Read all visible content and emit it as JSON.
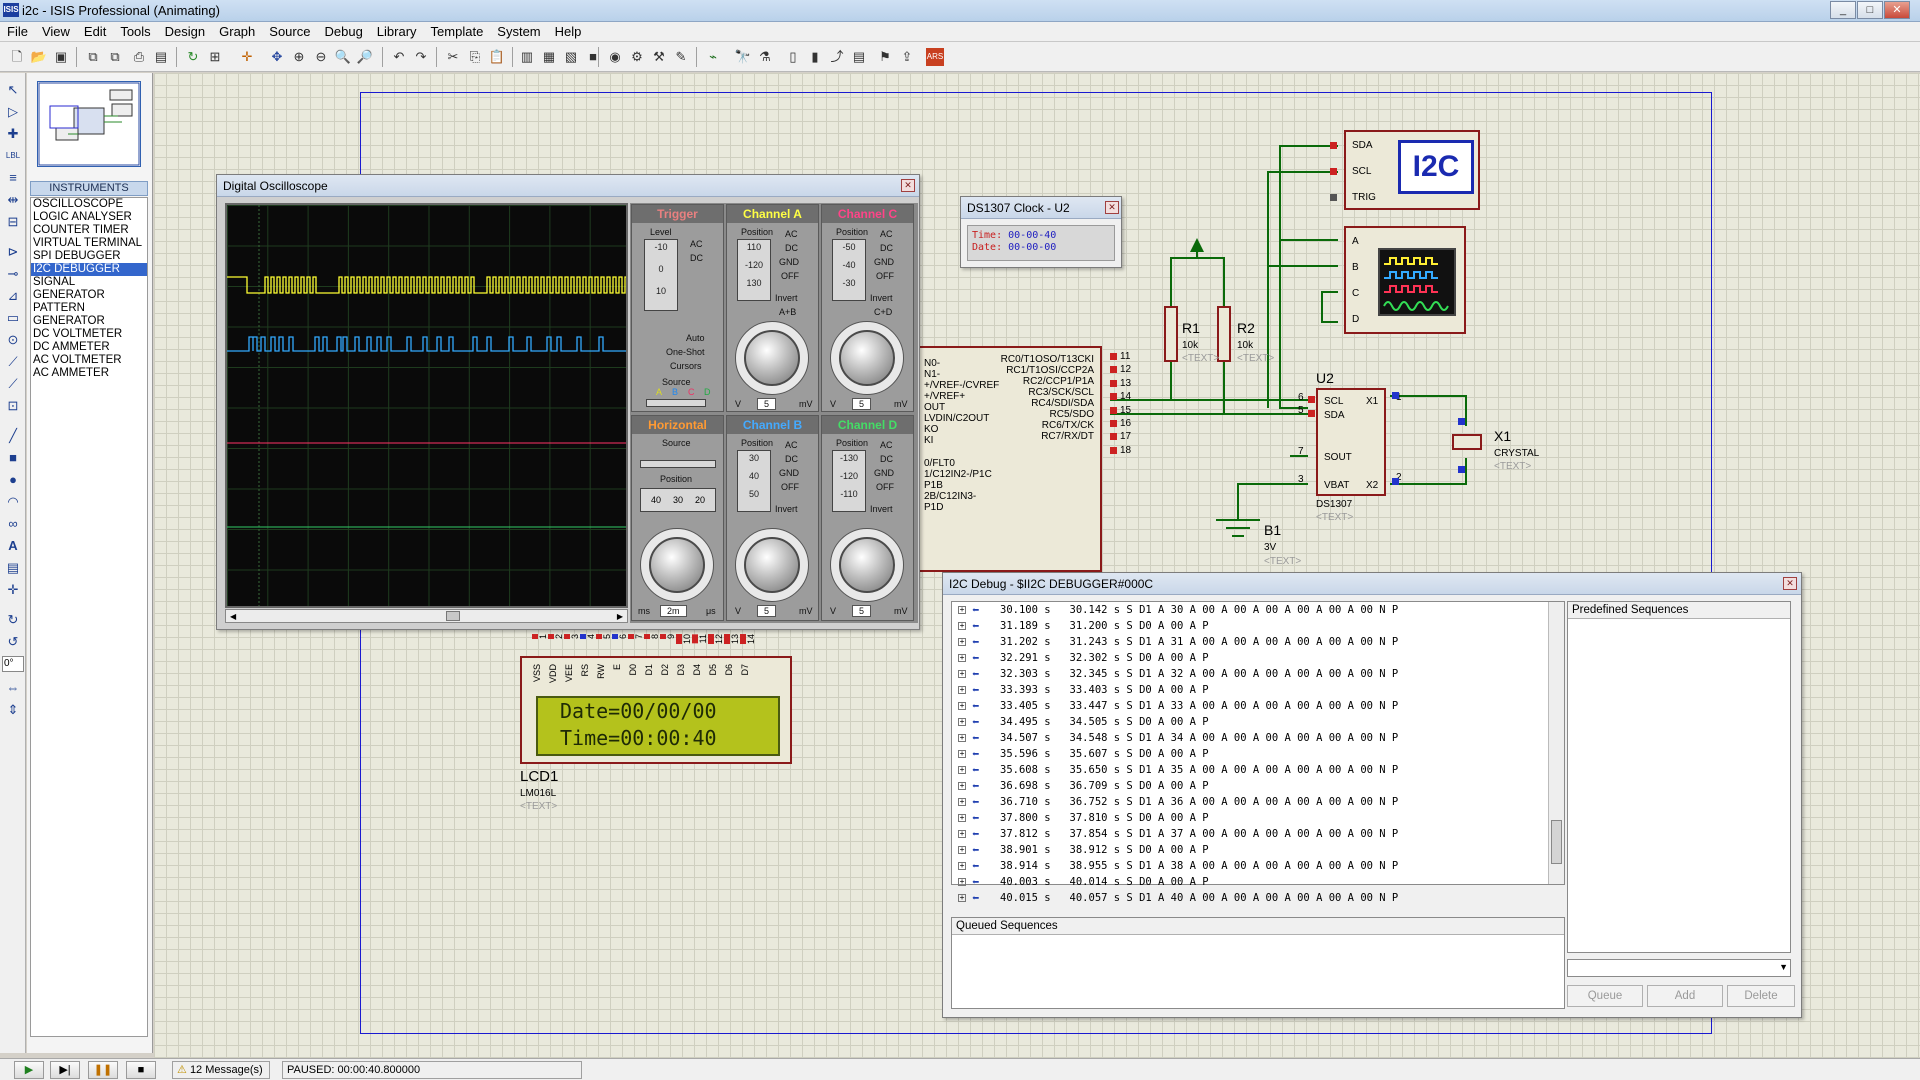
{
  "app": {
    "title": "i2c - ISIS Professional (Animating)",
    "logo": "ISIS"
  },
  "menu": [
    "File",
    "View",
    "Edit",
    "Tools",
    "Design",
    "Graph",
    "Source",
    "Debug",
    "Library",
    "Template",
    "System",
    "Help"
  ],
  "instruments": {
    "header": "INSTRUMENTS",
    "items": [
      "OSCILLOSCOPE",
      "LOGIC ANALYSER",
      "COUNTER TIMER",
      "VIRTUAL TERMINAL",
      "SPI DEBUGGER",
      "I2C DEBUGGER",
      "SIGNAL GENERATOR",
      "PATTERN GENERATOR",
      "DC VOLTMETER",
      "DC AMMETER",
      "AC VOLTMETER",
      "AC AMMETER"
    ],
    "selected_index": 5
  },
  "angle_field": "0°",
  "status": {
    "messages": "12 Message(s)",
    "state": "PAUSED: 00:00:40.800000"
  },
  "oscilloscope": {
    "title": "Digital Oscilloscope",
    "trigger": {
      "title": "Trigger",
      "level_label": "Level",
      "ticks": [
        "-10",
        "0",
        "10"
      ],
      "ac": "AC",
      "dc": "DC",
      "auto": "Auto",
      "one_shot": "One-Shot",
      "cursors": "Cursors",
      "source": "Source",
      "channels": [
        "A",
        "B",
        "C",
        "D"
      ]
    },
    "channel_a": {
      "title": "Channel A",
      "position": "Position",
      "ticks": [
        "110",
        "-120",
        "130"
      ],
      "modes": [
        "AC",
        "DC",
        "GND",
        "OFF"
      ],
      "invert": "Invert",
      "sum": "A+B",
      "v": "V",
      "mv": "mV",
      "value": "5"
    },
    "channel_c": {
      "title": "Channel C",
      "position": "Position",
      "ticks": [
        "-50",
        "-40",
        "-30"
      ],
      "modes": [
        "AC",
        "DC",
        "GND",
        "OFF"
      ],
      "invert": "Invert",
      "sum": "C+D",
      "v": "V",
      "mv": "mV",
      "value": "5"
    },
    "horizontal": {
      "title": "Horizontal",
      "source": "Source",
      "position": "Position",
      "ticks": [
        "40",
        "30",
        "20"
      ],
      "ms": "ms",
      "us": "μs",
      "value": "2m"
    },
    "channel_b": {
      "title": "Channel B",
      "position": "Position",
      "ticks": [
        "30",
        "40",
        "50"
      ],
      "modes": [
        "AC",
        "DC",
        "GND",
        "OFF"
      ],
      "invert": "Invert",
      "v": "V",
      "mv": "mV",
      "value": "5"
    },
    "channel_d": {
      "title": "Channel D",
      "position": "Position",
      "ticks": [
        "-130",
        "-120",
        "-110"
      ],
      "modes": [
        "AC",
        "DC",
        "GND",
        "OFF"
      ],
      "invert": "Invert",
      "v": "V",
      "mv": "mV",
      "value": "5"
    },
    "colors": {
      "a": "#ffff33",
      "b": "#33aaff",
      "c": "#ff3366",
      "d": "#33cc66"
    }
  },
  "ds1307_window": {
    "title": "DS1307 Clock - U2",
    "time_label": "Time:",
    "time": "00-00-40",
    "date_label": "Date:",
    "date": "00-00-00"
  },
  "lcd": {
    "line1": "Date=00/00/00",
    "line2": "Time=00:00:40",
    "ref": "LCD1",
    "model": "LM016L",
    "text": "<TEXT>",
    "pins": [
      "VSS",
      "VDD",
      "VEE",
      "RS",
      "RW",
      "E",
      "D0",
      "D1",
      "D2",
      "D3",
      "D4",
      "D5",
      "D6",
      "D7"
    ]
  },
  "schematic": {
    "i2c_box": {
      "label": "I2C",
      "pins": [
        "SDA",
        "SCL",
        "TRIG"
      ]
    },
    "scope_box": {
      "pins": [
        "A",
        "B",
        "C",
        "D"
      ]
    },
    "r1": {
      "ref": "R1",
      "value": "10k",
      "text": "<TEXT>"
    },
    "r2": {
      "ref": "R2",
      "value": "10k",
      "text": "<TEXT>"
    },
    "u2": {
      "ref": "U2",
      "model": "DS1307",
      "text": "<TEXT>",
      "pins_left": [
        "SCL",
        "SDA",
        "SOUT",
        "VBAT"
      ],
      "pins_right": [
        "X1",
        "X2"
      ],
      "pin_nums": [
        "6",
        "5",
        "7",
        "3",
        "1",
        "2"
      ]
    },
    "x1": {
      "ref": "X1",
      "model": "CRYSTAL",
      "text": "<TEXT>"
    },
    "b1": {
      "ref": "B1",
      "value": "3V",
      "text": "<TEXT>"
    },
    "mcu_right": [
      "RC0/T1OSO/T13CKI",
      "RC1/T1OSI/CCP2A",
      "RC2/CCP1/P1A",
      "RC3/SCK/SCL",
      "RC4/SDI/SDA",
      "RC5/SDO",
      "RC6/TX/CK",
      "RC7/RX/DT"
    ],
    "mcu_right_nums": [
      "11",
      "12",
      "13",
      "14",
      "15",
      "16",
      "17",
      "18"
    ],
    "mcu_left": [
      "N0-",
      "N1-",
      "+/VREF-/CVREF",
      "+/VREF+",
      "OUT",
      "LVDIN/C2OUT",
      "KO",
      "KI",
      "0/FLT0",
      "1/C12IN2-/P1C",
      "P1B",
      "2B/C12IN3-",
      "P1D"
    ],
    "lcd_pin_nums": [
      "1",
      "2",
      "3",
      "4",
      "5",
      "6",
      "7",
      "8",
      "9",
      "10",
      "11",
      "12",
      "13",
      "14"
    ]
  },
  "i2c_debug": {
    "title": "I2C Debug - $II2C DEBUGGER#000C",
    "rows": [
      "30.100 s   30.142 s S D1 A 30 A 00 A 00 A 00 A 00 A 00 A 00 N P",
      "31.189 s   31.200 s S D0 A 00 A P",
      "31.202 s   31.243 s S D1 A 31 A 00 A 00 A 00 A 00 A 00 A 00 N P",
      "32.291 s   32.302 s S D0 A 00 A P",
      "32.303 s   32.345 s S D1 A 32 A 00 A 00 A 00 A 00 A 00 A 00 N P",
      "33.393 s   33.403 s S D0 A 00 A P",
      "33.405 s   33.447 s S D1 A 33 A 00 A 00 A 00 A 00 A 00 A 00 N P",
      "34.495 s   34.505 s S D0 A 00 A P",
      "34.507 s   34.548 s S D1 A 34 A 00 A 00 A 00 A 00 A 00 A 00 N P",
      "35.596 s   35.607 s S D0 A 00 A P",
      "35.608 s   35.650 s S D1 A 35 A 00 A 00 A 00 A 00 A 00 A 00 N P",
      "36.698 s   36.709 s S D0 A 00 A P",
      "36.710 s   36.752 s S D1 A 36 A 00 A 00 A 00 A 00 A 00 A 00 N P",
      "37.800 s   37.810 s S D0 A 00 A P",
      "37.812 s   37.854 s S D1 A 37 A 00 A 00 A 00 A 00 A 00 A 00 N P",
      "38.901 s   38.912 s S D0 A 00 A P",
      "38.914 s   38.955 s S D1 A 38 A 00 A 00 A 00 A 00 A 00 A 00 N P",
      "40.003 s   40.014 s S D0 A 00 A P",
      "40.015 s   40.057 s S D1 A 40 A 00 A 00 A 00 A 00 A 00 A 00 N P"
    ],
    "predefined": "Predefined Sequences",
    "queued": "Queued Sequences",
    "buttons": {
      "queue": "Queue",
      "add": "Add",
      "delete": "Delete"
    }
  }
}
